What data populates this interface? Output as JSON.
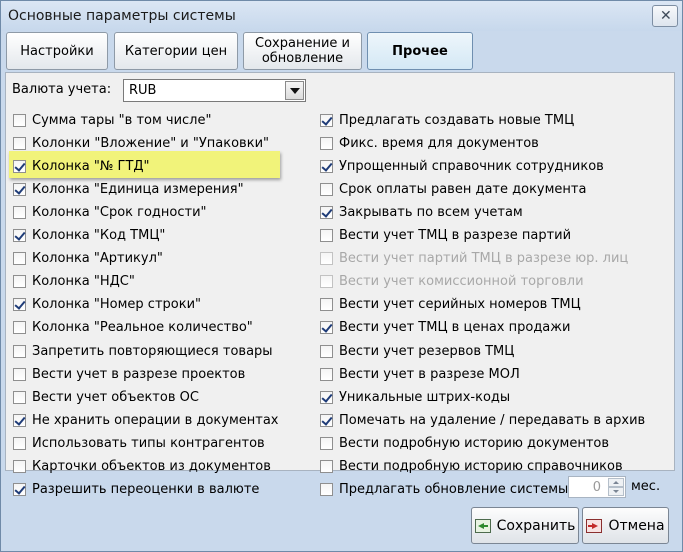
{
  "window": {
    "title": "Основные параметры системы",
    "close_glyph": "✕"
  },
  "tabs": [
    {
      "label": "Настройки",
      "active": false
    },
    {
      "label": "Категории цен",
      "active": false
    },
    {
      "label": "Сохранение и обновление",
      "active": false
    },
    {
      "label": "Прочее",
      "active": true
    }
  ],
  "currency": {
    "label": "Валюта учета:",
    "value": "RUB"
  },
  "left_options": [
    {
      "label": "Сумма тары \"в том числе\"",
      "checked": false
    },
    {
      "label": "Колонки \"Вложение\" и \"Упаковки\"",
      "checked": false
    },
    {
      "label": "Колонка \"№ ГТД\"",
      "checked": true
    },
    {
      "label": "Колонка \"Единица измерения\"",
      "checked": true
    },
    {
      "label": "Колонка \"Срок годности\"",
      "checked": false
    },
    {
      "label": "Колонка \"Код ТМЦ\"",
      "checked": true
    },
    {
      "label": "Колонка \"Артикул\"",
      "checked": false
    },
    {
      "label": "Колонка \"НДС\"",
      "checked": false
    },
    {
      "label": "Колонка \"Номер строки\"",
      "checked": true
    },
    {
      "label": "Колонка \"Реальное количество\"",
      "checked": false
    },
    {
      "label": "Запретить повторяющиеся товары",
      "checked": false
    },
    {
      "label": "Вести учет в разрезе  проектов",
      "checked": false
    },
    {
      "label": "Вести учет объектов ОС",
      "checked": false
    },
    {
      "label": "Не хранить операции в документах",
      "checked": true
    },
    {
      "label": "Использовать типы контрагентов",
      "checked": false
    },
    {
      "label": "Карточки объектов из документов",
      "checked": false
    },
    {
      "label": "Разрешить переоценки в валюте",
      "checked": true
    }
  ],
  "right_options": [
    {
      "label": "Предлагать создавать новые ТМЦ",
      "checked": true,
      "disabled": false
    },
    {
      "label": "Фикс. время для документов",
      "checked": false,
      "disabled": false
    },
    {
      "label": "Упрощенный справочник сотрудников",
      "checked": true,
      "disabled": false
    },
    {
      "label": "Срок оплаты равен дате документа",
      "checked": false,
      "disabled": false
    },
    {
      "label": "Закрывать по всем учетам",
      "checked": true,
      "disabled": false
    },
    {
      "label": "Вести учет ТМЦ в разрезе партий",
      "checked": false,
      "disabled": false
    },
    {
      "label": "Вести учет партий ТМЦ в разрезе юр. лиц",
      "checked": false,
      "disabled": true
    },
    {
      "label": "Вести учет комиссионной торговли",
      "checked": false,
      "disabled": true
    },
    {
      "label": "Вести учет серийных номеров ТМЦ",
      "checked": false,
      "disabled": false
    },
    {
      "label": "Вести учет ТМЦ в ценах продажи",
      "checked": true,
      "disabled": false
    },
    {
      "label": "Вести учет резервов ТМЦ",
      "checked": false,
      "disabled": false
    },
    {
      "label": "Вести учет в разрезе МОЛ",
      "checked": false,
      "disabled": false
    },
    {
      "label": "Уникальные штрих-коды",
      "checked": true,
      "disabled": false
    },
    {
      "label": "Помечать на удаление / передавать в архив",
      "checked": true,
      "disabled": false
    },
    {
      "label": "Вести подробную историю документов",
      "checked": false,
      "disabled": false
    },
    {
      "label": "Вести подробную историю справочников",
      "checked": false,
      "disabled": false
    },
    {
      "label": "Предлагать обновление системы",
      "checked": false,
      "disabled": false
    }
  ],
  "update_interval": {
    "value": "0",
    "unit": "мес."
  },
  "buttons": {
    "save_label": "Сохранить",
    "cancel_label": "Отмена"
  },
  "highlight_color": "#f1f37a"
}
